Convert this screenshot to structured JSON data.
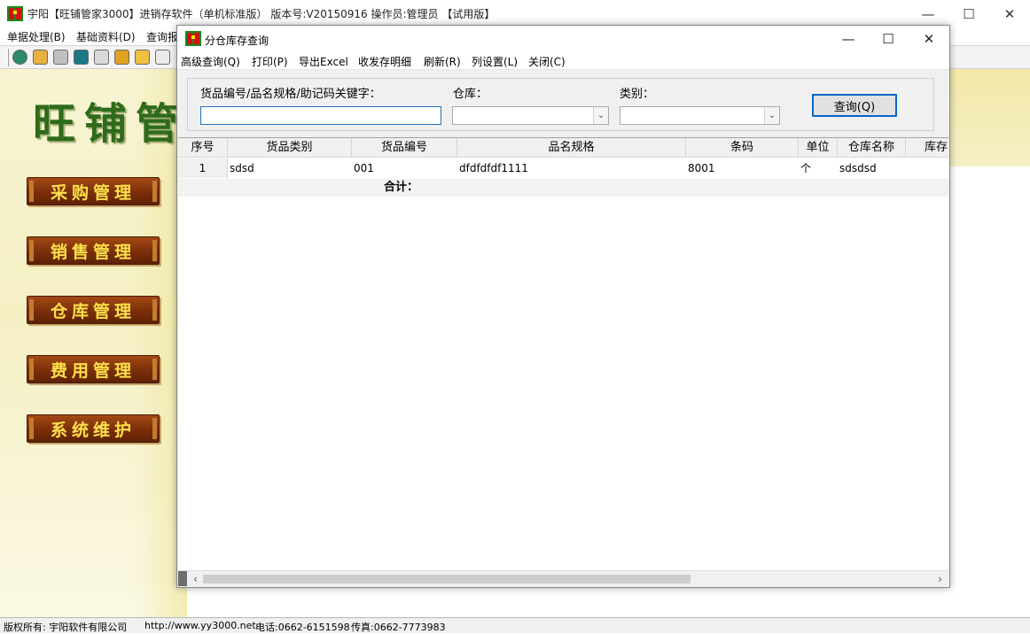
{
  "main_window": {
    "title": "宇阳【旺铺管家3000】进销存软件（单机标准版） 版本号:V20150916 操作员:管理员 【试用版】",
    "controls": {
      "minimize": "—",
      "maximize": "☐",
      "close": "✕"
    },
    "menu": [
      "单据处理(B)",
      "基础资料(D)",
      "查询报"
    ],
    "toolbar_icons": [
      "report-icon",
      "edit-icon",
      "database-icon",
      "database-icon",
      "database-icon",
      "box-icon",
      "box-icon",
      "document-icon"
    ]
  },
  "left_panel": {
    "logo": "旺铺管",
    "nav_buttons": [
      "采购管理",
      "销售管理",
      "仓库管理",
      "费用管理",
      "系统维护"
    ]
  },
  "status_bar": {
    "copyright": "版权所有: 宇阳软件有限公司",
    "website": "http://www.yy3000.net",
    "phone": "电话:0662-6151598",
    "fax": "传真:0662-7773983"
  },
  "dialog": {
    "title": "分仓库存查询",
    "controls": {
      "minimize": "—",
      "maximize": "☐",
      "close": "✕"
    },
    "menu": [
      "高级查询(Q)",
      "打印(P)",
      "导出Excel",
      "收发存明细",
      "刷新(R)",
      "列设置(L)",
      "关闭(C)"
    ],
    "filters": {
      "keyword_label": "货品编号/品名规格/助记码关键字：",
      "keyword_value": "",
      "warehouse_label": "仓库：",
      "warehouse_value": "",
      "category_label": "类别：",
      "category_value": "",
      "query_button": "查询(Q)"
    },
    "table": {
      "columns": [
        "序号",
        "货品类别",
        "货品编号",
        "品名规格",
        "条码",
        "单位",
        "仓库名称",
        "库存"
      ],
      "rows": [
        [
          "1",
          "sdsd",
          "001",
          "dfdfdfdf1111",
          "8001",
          "个",
          "sdsdsd",
          ""
        ]
      ],
      "total_label": "合计："
    }
  }
}
